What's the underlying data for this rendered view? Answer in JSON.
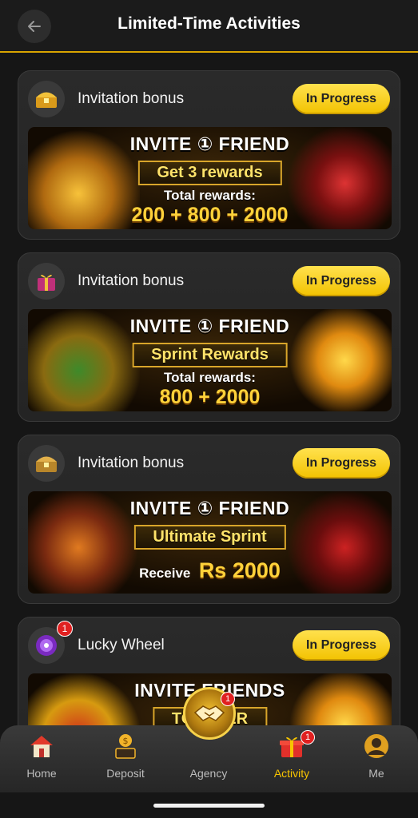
{
  "header": {
    "title": "Limited-Time Activities"
  },
  "colors": {
    "accent": "#f7c400",
    "badge": "#e02020",
    "background": "#161616"
  },
  "activities": [
    {
      "title": "Invitation bonus",
      "status": "In Progress",
      "icon": "treasure-chest-icon",
      "banner": {
        "line1": "INVITE ① FRIEND",
        "ribbon": "Get 3 rewards",
        "line3": "Total rewards:",
        "line4": "200 + 800 + 2000"
      }
    },
    {
      "title": "Invitation bonus",
      "status": "In Progress",
      "icon": "gift-box-icon",
      "banner": {
        "line1": "INVITE ① FRIEND",
        "ribbon": "Sprint Rewards",
        "line3": "Total rewards:",
        "line4": "800 + 2000"
      }
    },
    {
      "title": "Invitation bonus",
      "status": "In Progress",
      "icon": "treasure-chest-icon",
      "banner": {
        "line1": "INVITE ① FRIEND",
        "ribbon": "Ultimate Sprint",
        "receive_label": "Receive",
        "receive_amount": "Rs 2000"
      }
    },
    {
      "title": "Lucky Wheel",
      "status": "In Progress",
      "icon": "lucky-wheel-icon",
      "badge": "1",
      "banner": {
        "line1": "INVITE FRIENDS",
        "ribbon": "TO ... TER"
      }
    }
  ],
  "nav": {
    "items": [
      {
        "label": "Home",
        "icon": "home-icon"
      },
      {
        "label": "Deposit",
        "icon": "deposit-icon"
      },
      {
        "label": "Agency",
        "icon": "agency-handshake-icon",
        "badge": "1"
      },
      {
        "label": "Activity",
        "icon": "gift-icon",
        "badge": "1",
        "active": true
      },
      {
        "label": "Me",
        "icon": "profile-icon"
      }
    ]
  }
}
